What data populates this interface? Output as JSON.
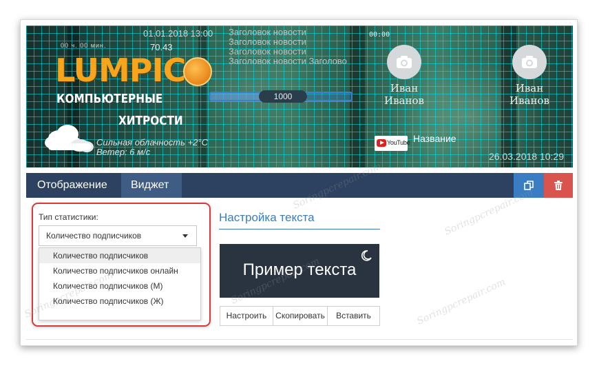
{
  "banner": {
    "date_top": "01.01.2018 13:00",
    "counter": "00 ч. 00 мин.",
    "number": "70.43",
    "news": [
      "Заголовок новости",
      "Заголовок новости",
      "Заголовок новости",
      "Заголовок новости Заголово"
    ],
    "time_small": "00:00",
    "logo": "LUMPICS",
    "subtitle_1": "КОМПЬЮТЕРНЫЕ",
    "subtitle_2": "ХИТРОСТИ",
    "weather_1": "Сильная облачность +2°C",
    "weather_2": "Ветер: 6 м/с",
    "progress_label": "1000",
    "progress_fraction": 0.5,
    "users": [
      {
        "first": "Иван",
        "last": "Иванов"
      },
      {
        "first": "Иван",
        "last": "Иванов"
      }
    ],
    "youtube_logo": "YouTube",
    "youtube_name": "Название",
    "date_bottom": "26.03.2018 10:29"
  },
  "tabs": [
    {
      "label": "Отображение",
      "active": false
    },
    {
      "label": "Виджет",
      "active": true
    }
  ],
  "toolbar": {
    "copy_icon": "copy-icon",
    "delete_icon": "trash-icon",
    "delete_color": "#d9534f",
    "copy_color": "#3b7dc3"
  },
  "stat": {
    "label": "Тип статистики:",
    "selected": "Количество подписчиков",
    "options": [
      "Количество подписчиков",
      "Количество подписчиков онлайн",
      "Количество подписчиков (М)",
      "Количество подписчиков (Ж)"
    ]
  },
  "text_settings": {
    "title": "Настройка текста",
    "preview": "Пример текста",
    "buttons": [
      "Настроить",
      "Скопировать",
      "Вставить"
    ]
  },
  "watermark": "Soringpcrepair.com"
}
